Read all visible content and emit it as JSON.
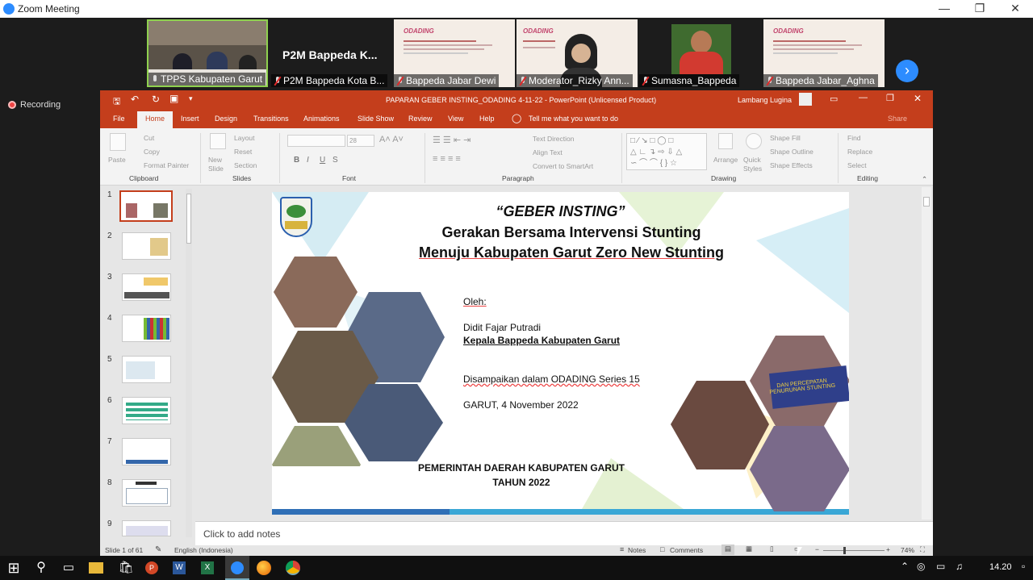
{
  "zoom": {
    "title": "Zoom Meeting",
    "recording": "Recording",
    "next_icon": "chevron-right-icon",
    "participants": [
      {
        "name": "TPPS Kabupaten Garut",
        "muted": false,
        "kind": "video"
      },
      {
        "name": "P2M Bappeda Kota B...",
        "big": "P2M  Bappeda  K...",
        "muted": true,
        "kind": "name"
      },
      {
        "name": "Bappeda Jabar Dewi",
        "muted": true,
        "kind": "slide",
        "hd": "ODADING"
      },
      {
        "name": "Moderator_Rizky Ann...",
        "muted": true,
        "kind": "video"
      },
      {
        "name": "Sumasna_Bappeda",
        "muted": true,
        "kind": "video"
      },
      {
        "name": "Bappeda Jabar_Aghna",
        "muted": true,
        "kind": "slide",
        "hd": "ODADING"
      }
    ]
  },
  "ppt": {
    "doc_title": "PAPARAN GEBER INSTING_ODADING 4-11-22  -  PowerPoint (Unlicensed Product)",
    "user": "Lambang Lugina",
    "share": "Share",
    "tabs": [
      "File",
      "Home",
      "Insert",
      "Design",
      "Transitions",
      "Animations",
      "Slide Show",
      "Review",
      "View",
      "Help"
    ],
    "tell": "Tell me what you want to do",
    "ribbon": {
      "paste": "Paste",
      "cut": "Cut",
      "copy": "Copy",
      "format_painter": "Format Painter",
      "clipboard": "Clipboard",
      "new_slide": "New Slide",
      "layout": "Layout",
      "reset": "Reset",
      "section": "Section",
      "slides": "Slides",
      "font_size": "28",
      "font": "Font",
      "paragraph": "Paragraph",
      "text_direction": "Text Direction",
      "align_text": "Align Text",
      "convert": "Convert to SmartArt",
      "arrange": "Arrange",
      "quick_styles": "Quick Styles",
      "shape_fill": "Shape Fill",
      "shape_outline": "Shape Outline",
      "shape_effects": "Shape Effects",
      "drawing": "Drawing",
      "find": "Find",
      "replace": "Replace",
      "select": "Select",
      "editing": "Editing"
    },
    "slide_numbers": [
      "1",
      "2",
      "3",
      "4",
      "5",
      "6",
      "7",
      "8",
      "9"
    ],
    "slide": {
      "title1": "“GEBER INSTING”",
      "title2": "Gerakan Bersama Intervensi Stunting",
      "title3": "Menuju Kabupaten Garut Zero New Stunting",
      "oleh": "Oleh:",
      "name": "Didit Fajar Putradi",
      "role": "Kepala Bappeda Kabupaten Garut",
      "disampaikan": "Disampaikan dalam ODADING Series 15",
      "date": "GARUT, 4 November 2022",
      "org": "PEMERINTAH DAERAH KABUPATEN GARUT",
      "year": "TAHUN 2022",
      "banner": "DAN PERCEPATAN PENURUNAN STUNTING"
    },
    "notes": "Click to add notes",
    "status": {
      "slide_of": "Slide 1 of 61",
      "lang": "English (Indonesia)",
      "notes": "Notes",
      "comments": "Comments",
      "zoom": "74%"
    }
  },
  "taskbar": {
    "time": "14.20"
  }
}
